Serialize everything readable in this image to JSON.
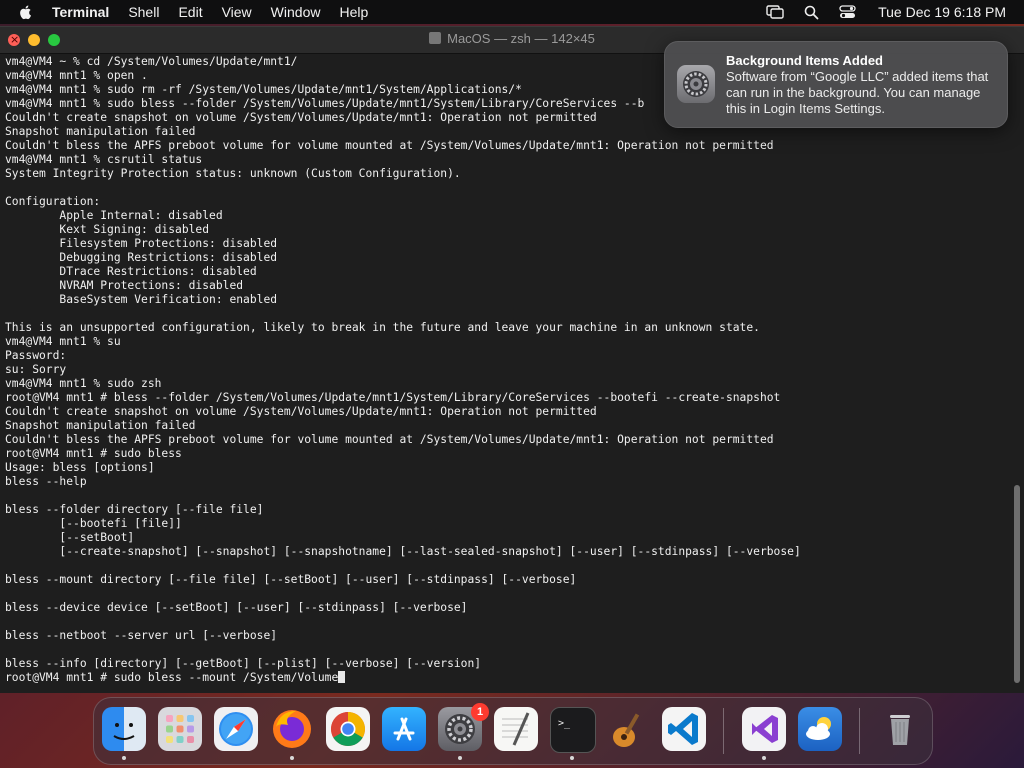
{
  "menubar": {
    "app_name": "Terminal",
    "items": [
      "Shell",
      "Edit",
      "View",
      "Window",
      "Help"
    ],
    "clock": "Tue Dec 19  6:18 PM"
  },
  "window": {
    "title": "MacOS — zsh — 142×45"
  },
  "terminal": {
    "lines": [
      "vm4@VM4 ~ % cd /System/Volumes/Update/mnt1/",
      "vm4@VM4 mnt1 % open .",
      "vm4@VM4 mnt1 % sudo rm -rf /System/Volumes/Update/mnt1/System/Applications/*",
      "vm4@VM4 mnt1 % sudo bless --folder /System/Volumes/Update/mnt1/System/Library/CoreServices --b",
      "Couldn't create snapshot on volume /System/Volumes/Update/mnt1: Operation not permitted",
      "Snapshot manipulation failed",
      "Couldn't bless the APFS preboot volume for volume mounted at /System/Volumes/Update/mnt1: Operation not permitted",
      "vm4@VM4 mnt1 % csrutil status",
      "System Integrity Protection status: unknown (Custom Configuration).",
      "",
      "Configuration:",
      "        Apple Internal: disabled",
      "        Kext Signing: disabled",
      "        Filesystem Protections: disabled",
      "        Debugging Restrictions: disabled",
      "        DTrace Restrictions: disabled",
      "        NVRAM Protections: disabled",
      "        BaseSystem Verification: enabled",
      "",
      "This is an unsupported configuration, likely to break in the future and leave your machine in an unknown state.",
      "vm4@VM4 mnt1 % su",
      "Password:",
      "su: Sorry",
      "vm4@VM4 mnt1 % sudo zsh",
      "root@VM4 mnt1 # bless --folder /System/Volumes/Update/mnt1/System/Library/CoreServices --bootefi --create-snapshot",
      "Couldn't create snapshot on volume /System/Volumes/Update/mnt1: Operation not permitted",
      "Snapshot manipulation failed",
      "Couldn't bless the APFS preboot volume for volume mounted at /System/Volumes/Update/mnt1: Operation not permitted",
      "root@VM4 mnt1 # sudo bless",
      "Usage: bless [options]",
      "bless --help",
      "",
      "bless --folder directory [--file file]",
      "        [--bootefi [file]]",
      "        [--setBoot]",
      "        [--create-snapshot] [--snapshot] [--snapshotname] [--last-sealed-snapshot] [--user] [--stdinpass] [--verbose]",
      "",
      "bless --mount directory [--file file] [--setBoot] [--user] [--stdinpass] [--verbose]",
      "",
      "bless --device device [--setBoot] [--user] [--stdinpass] [--verbose]",
      "",
      "bless --netboot --server url [--verbose]",
      "",
      "bless --info [directory] [--getBoot] [--plist] [--verbose] [--version]"
    ],
    "prompt_line": "root@VM4 mnt1 # sudo bless --mount /System/Volume"
  },
  "notification": {
    "title": "Background Items Added",
    "body": "Software from “Google LLC” added items that can run in the background. You can manage this in Login Items Settings."
  },
  "dock": {
    "items": [
      "finder",
      "launchpad",
      "safari",
      "firefox",
      "chrome",
      "app-store",
      "system-settings",
      "textedit",
      "terminal",
      "garageband",
      "vscode",
      "visual-studio",
      "weather",
      "trash"
    ],
    "settings_badge": "1"
  }
}
